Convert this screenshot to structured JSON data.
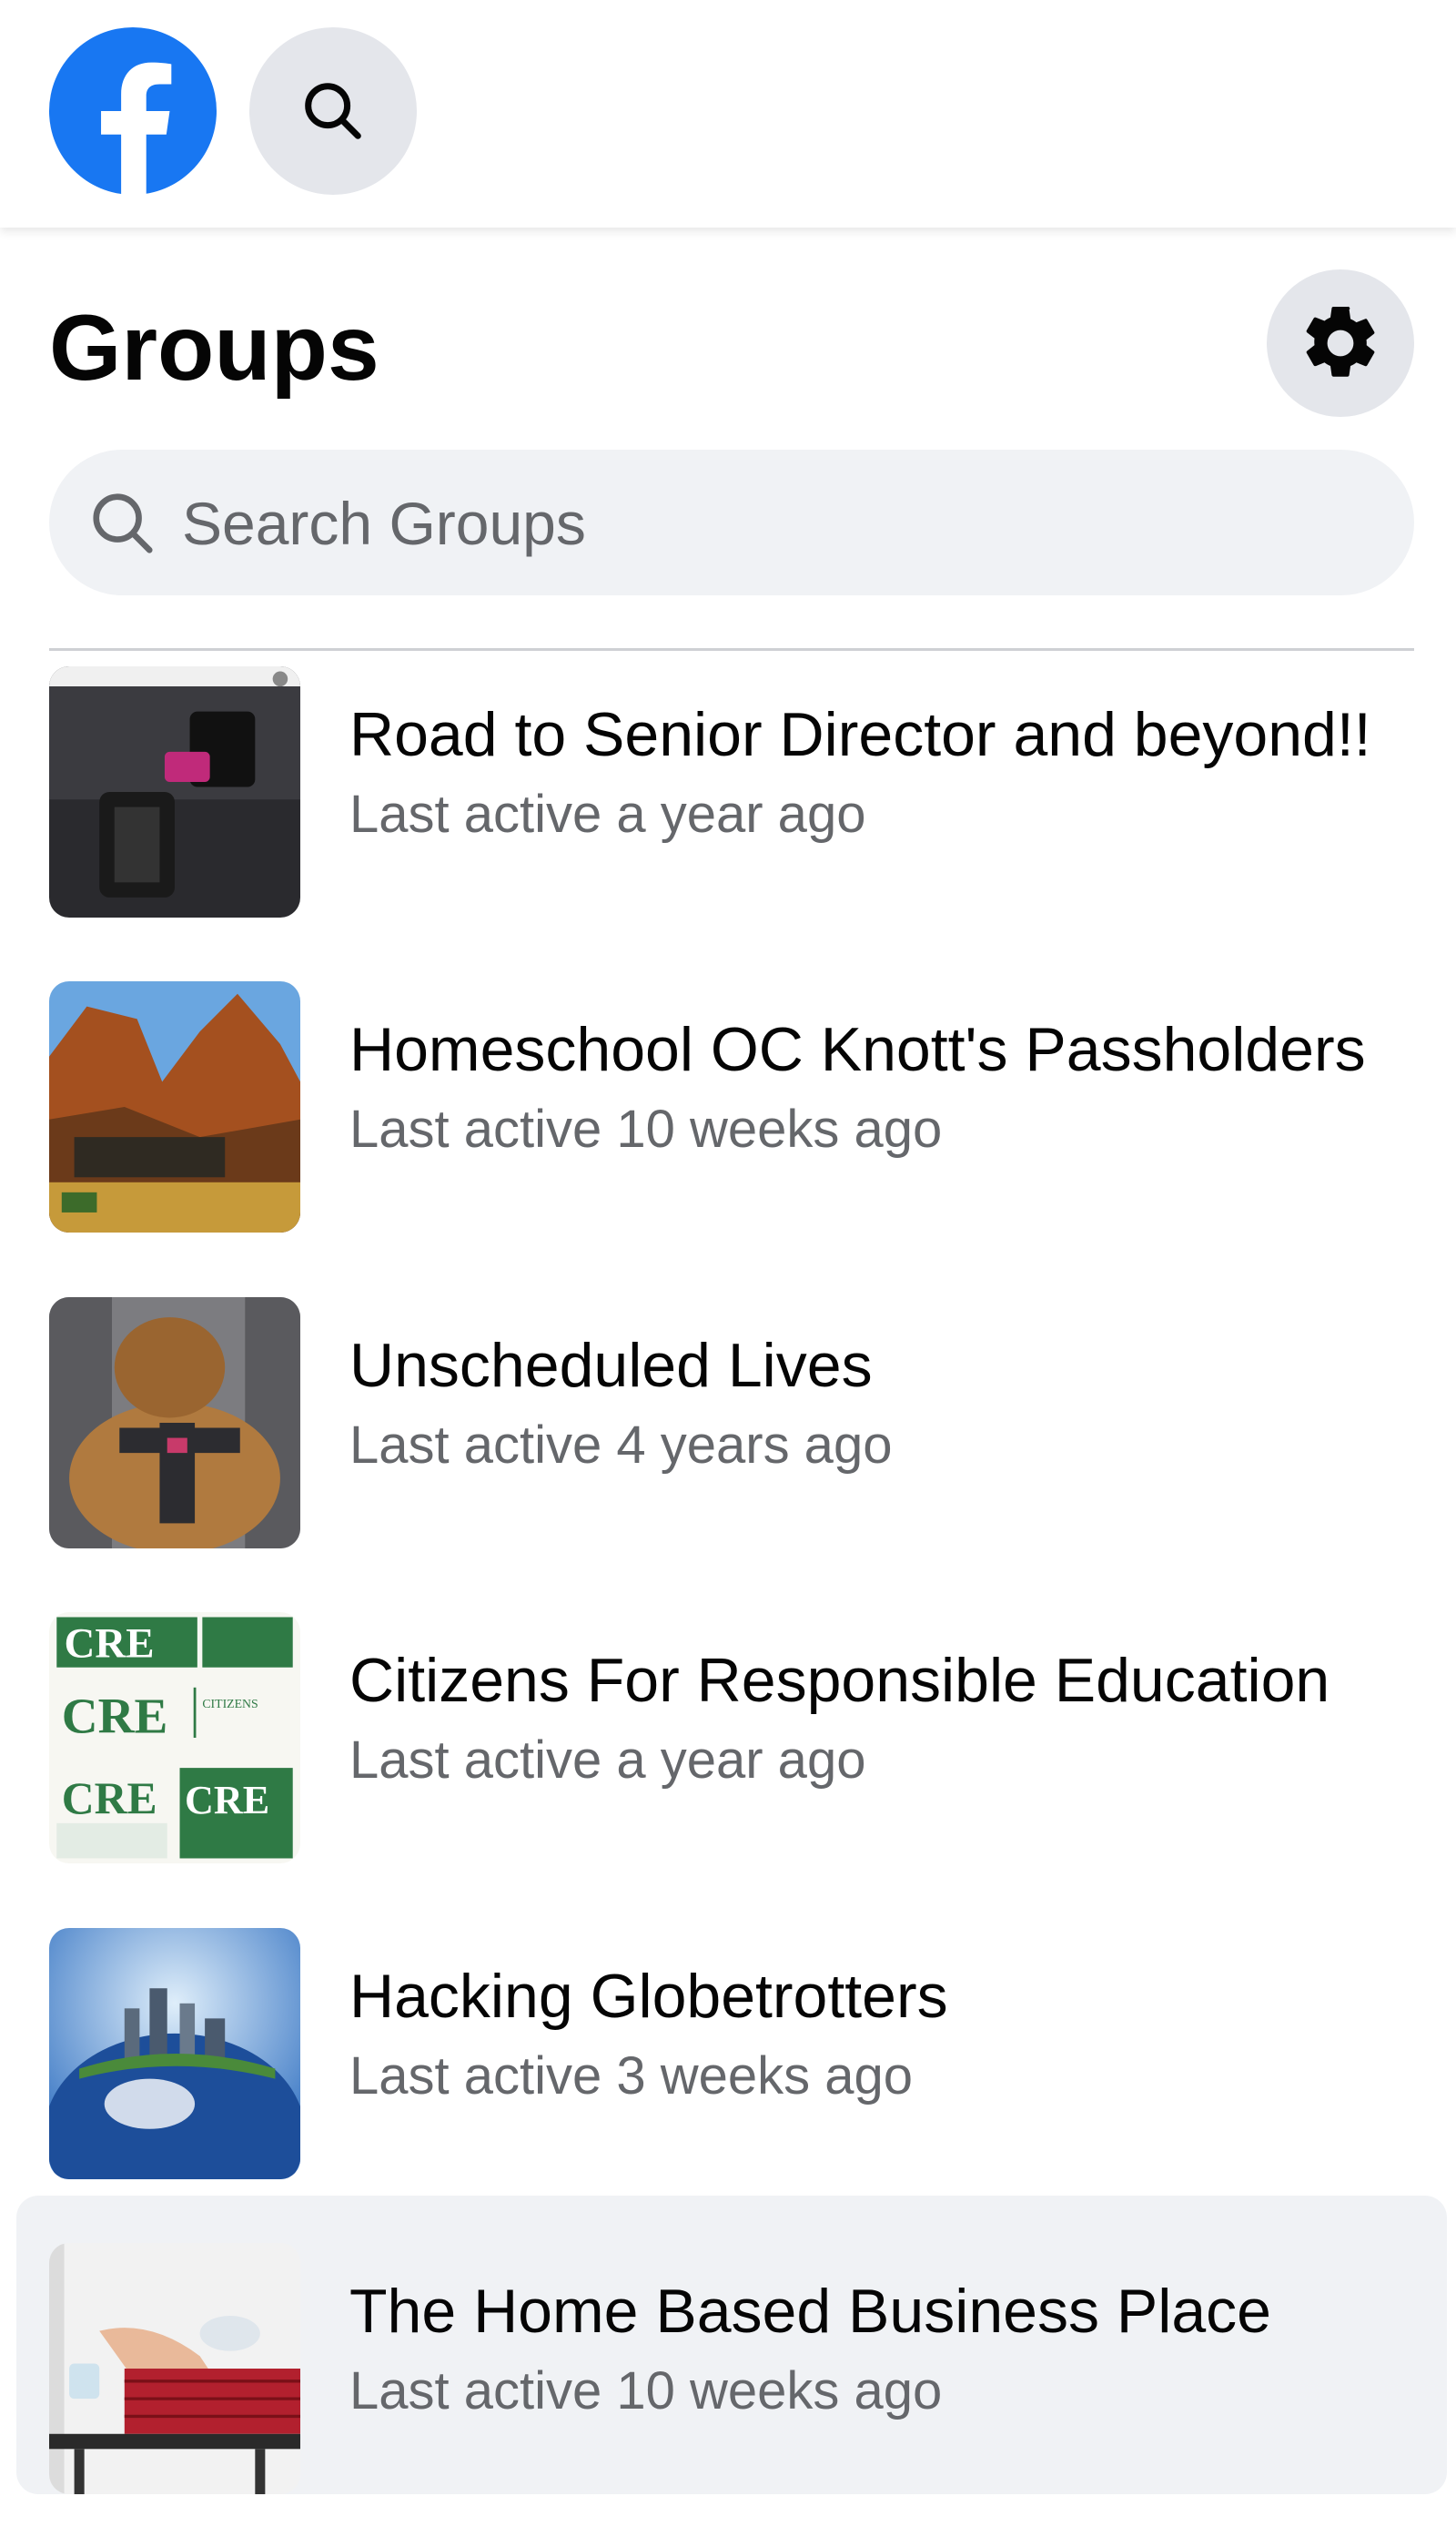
{
  "header": {
    "logo_icon": "facebook-logo-icon",
    "search_icon": "search-icon",
    "brand_color": "#1877f2"
  },
  "page": {
    "title": "Groups",
    "settings_icon": "gear-icon"
  },
  "search": {
    "placeholder": "Search Groups",
    "value": ""
  },
  "groups": [
    {
      "name": "Road to Senior Director and beyond!!",
      "status": "Last active a year ago",
      "thumb": "product-photo"
    },
    {
      "name": "Homeschool OC Knott's Passholders",
      "status": "Last active 10 weeks ago",
      "thumb": "rock-landscape"
    },
    {
      "name": "Unscheduled Lives",
      "status": "Last active 4 years ago",
      "thumb": "dog-photo"
    },
    {
      "name": "Citizens For Responsible Education",
      "status": "Last active a year ago",
      "thumb": "cre-logo"
    },
    {
      "name": "Hacking Globetrotters",
      "status": "Last active 3 weeks ago",
      "thumb": "globe-city"
    },
    {
      "name": "The Home Based Business Place",
      "status": "Last active 10 weeks ago",
      "thumb": "home-office-photo"
    }
  ],
  "thumb_text": {
    "cre_small": "CITIZENS"
  }
}
